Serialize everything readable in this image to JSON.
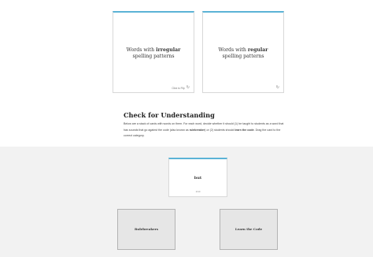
{
  "flashcards": [
    {
      "prefix": "Words with ",
      "bold": "irregular",
      "suffix": " spelling patterns",
      "flip_label": "Click to Flip",
      "icon": "flip-icon"
    },
    {
      "prefix": "Words with ",
      "bold": "regular",
      "suffix": " spelling patterns",
      "flip_label": "",
      "icon": "flip-icon"
    }
  ],
  "check": {
    "title": "Check for Understanding",
    "p1": "Below are a stack of cards with words on them. For each word, decide whether it should (1) be taught to students as a word that has sounds that go against the code (also known as ",
    "p1_bold": "rulebreaker",
    "p2": ") or (2) students should ",
    "p2_bold": "learn the code",
    "p3": ". Drag the card to the correct category."
  },
  "drag_card": {
    "word": "but",
    "count": "1/10"
  },
  "drop_zones": [
    {
      "label": "Rulebreakers"
    },
    {
      "label": "Learn the Code"
    }
  ],
  "colors": {
    "accent": "#5bb3d6",
    "activity_bg": "#f2f2f2",
    "zone_bg": "#e6e6e6"
  }
}
